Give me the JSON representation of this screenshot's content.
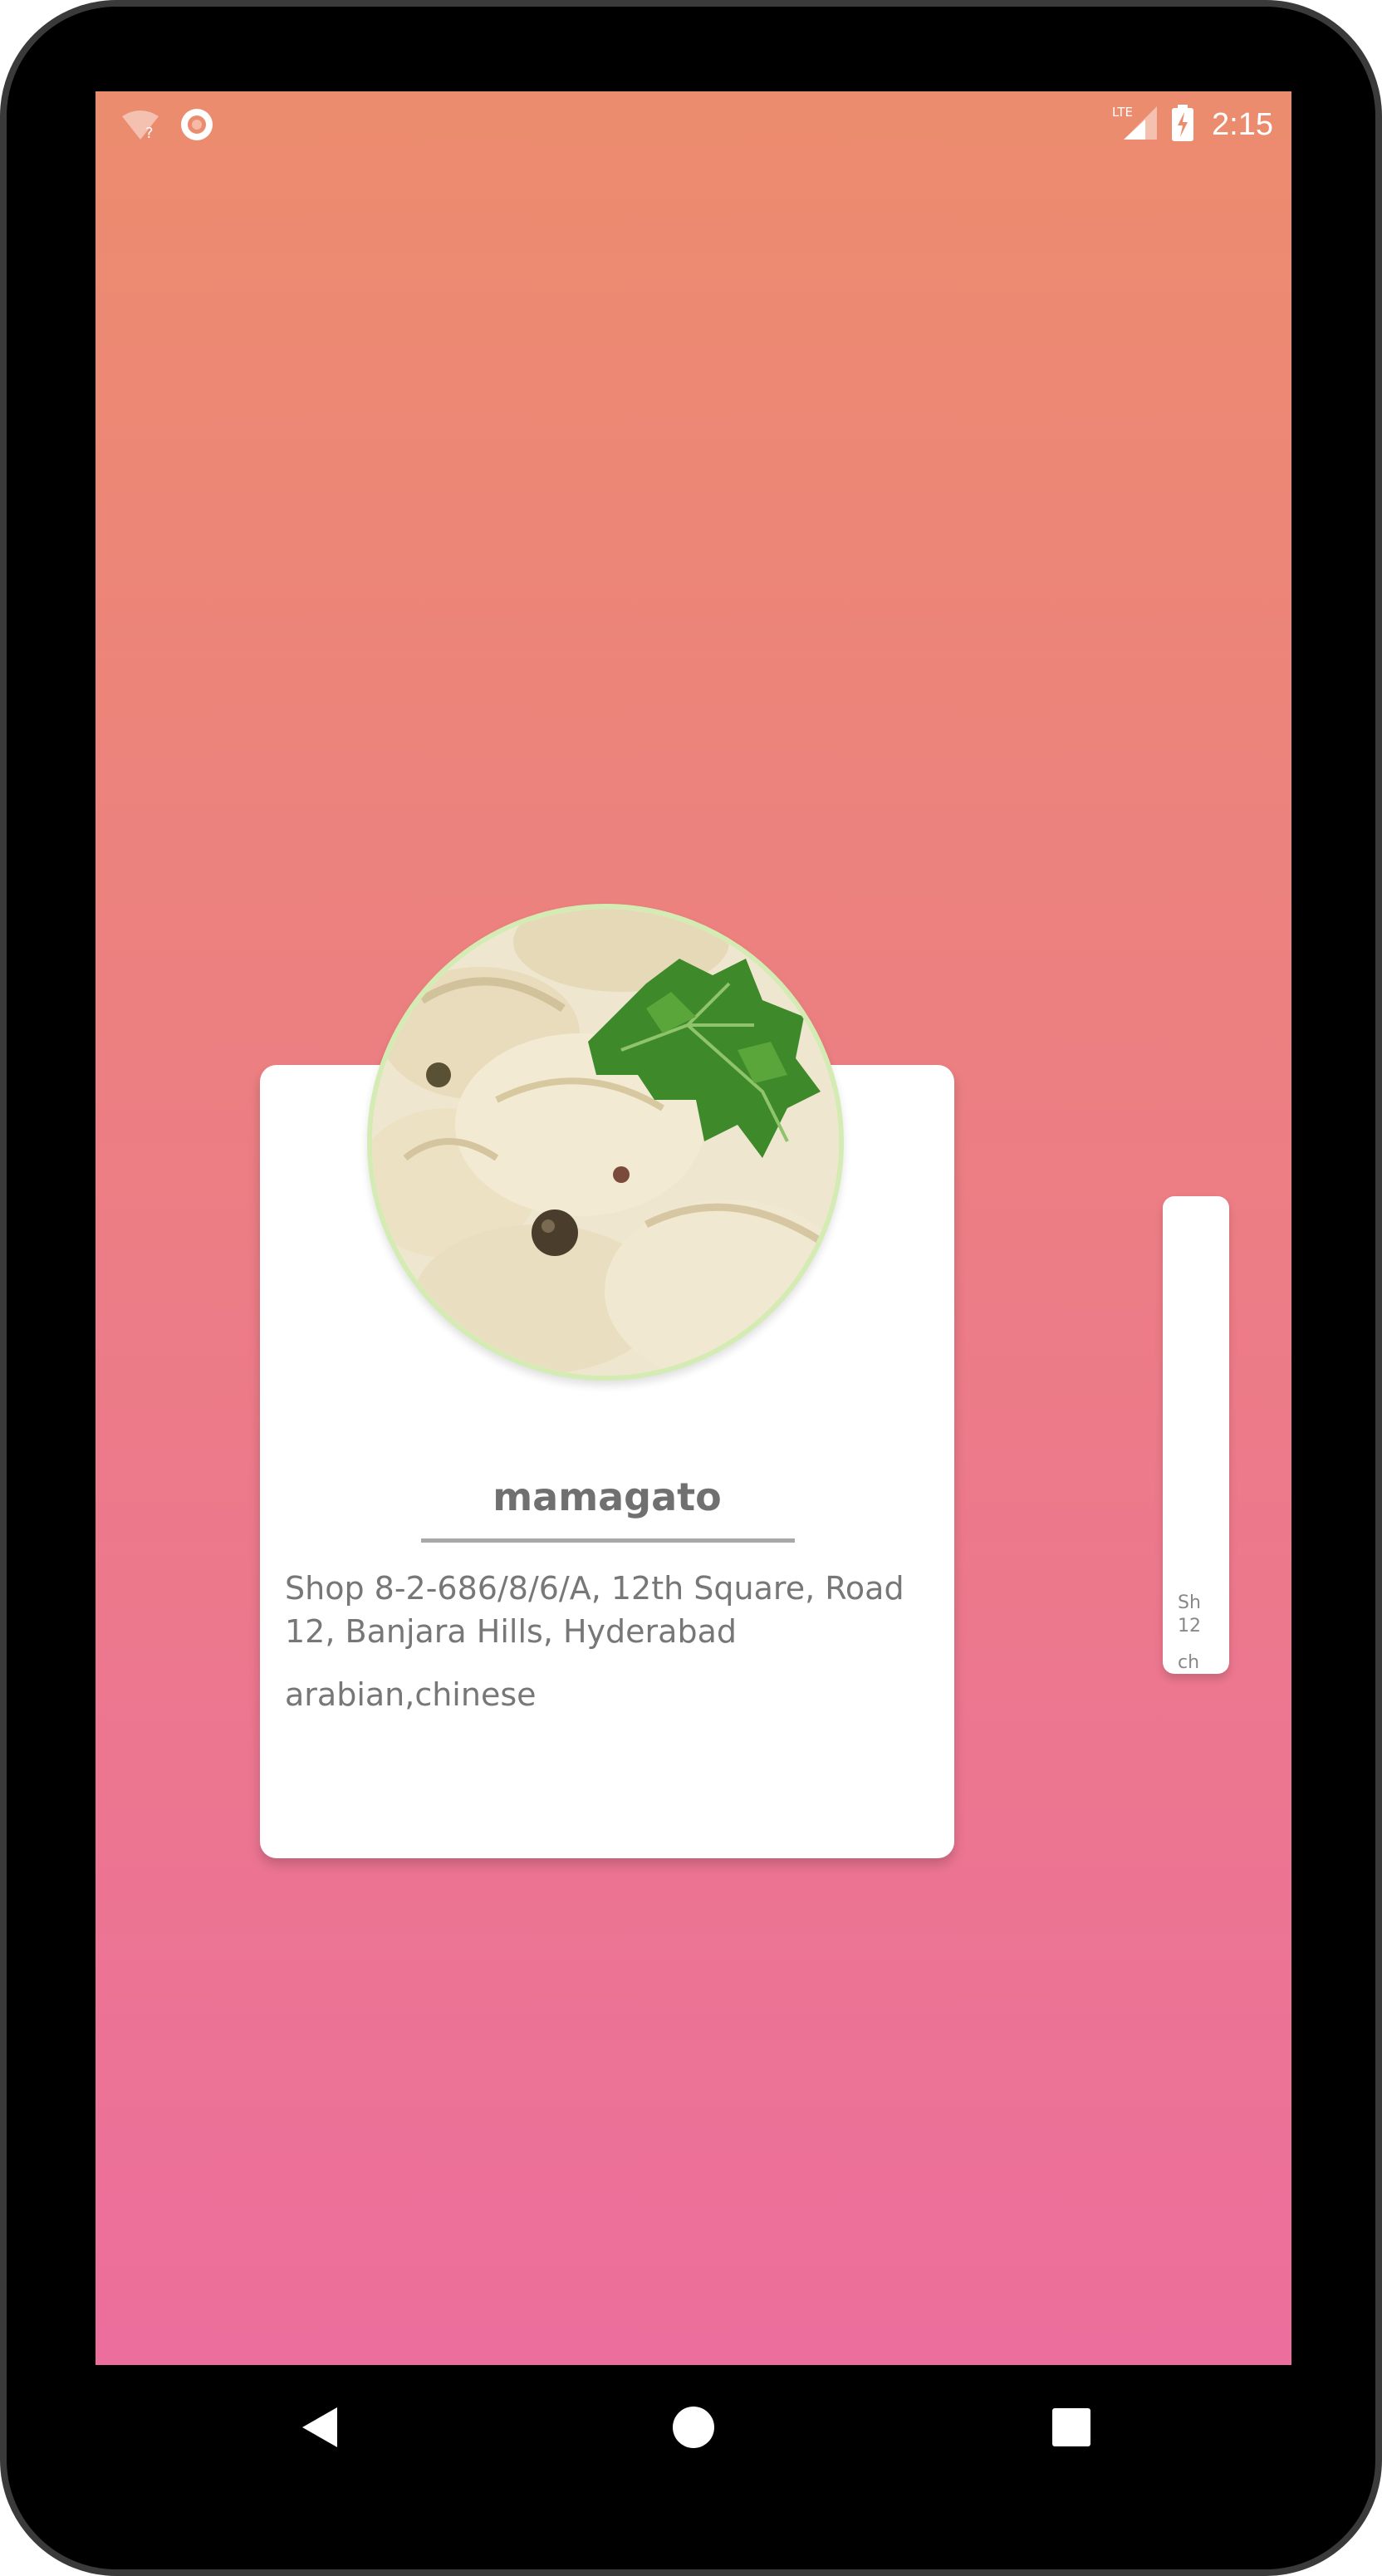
{
  "status_bar": {
    "time": "2:15",
    "network_label": "LTE",
    "icons": [
      "wifi-unknown-icon",
      "sync-circle-icon",
      "lte-signal-icon",
      "battery-charging-icon"
    ]
  },
  "restaurant_card": {
    "name": "mamagato",
    "address": "Shop 8-2-686/8/6/A, 12th Square, Road 12, Banjara Hills, Hyderabad",
    "cuisine": "arabian,chinese",
    "image": "dumplings-photo"
  },
  "next_card_peek": {
    "address_fragment_line1": "Sh",
    "address_fragment_line2": "12",
    "cuisine_fragment": "ch"
  },
  "navigation": {
    "buttons": [
      "back-icon",
      "home-icon",
      "recents-icon"
    ]
  },
  "colors": {
    "background_top": "#ec8c6e",
    "background_bottom": "#ec6e9c",
    "card": "#ffffff",
    "avatar_ring": "#d4ecb4",
    "text": "#777777"
  }
}
